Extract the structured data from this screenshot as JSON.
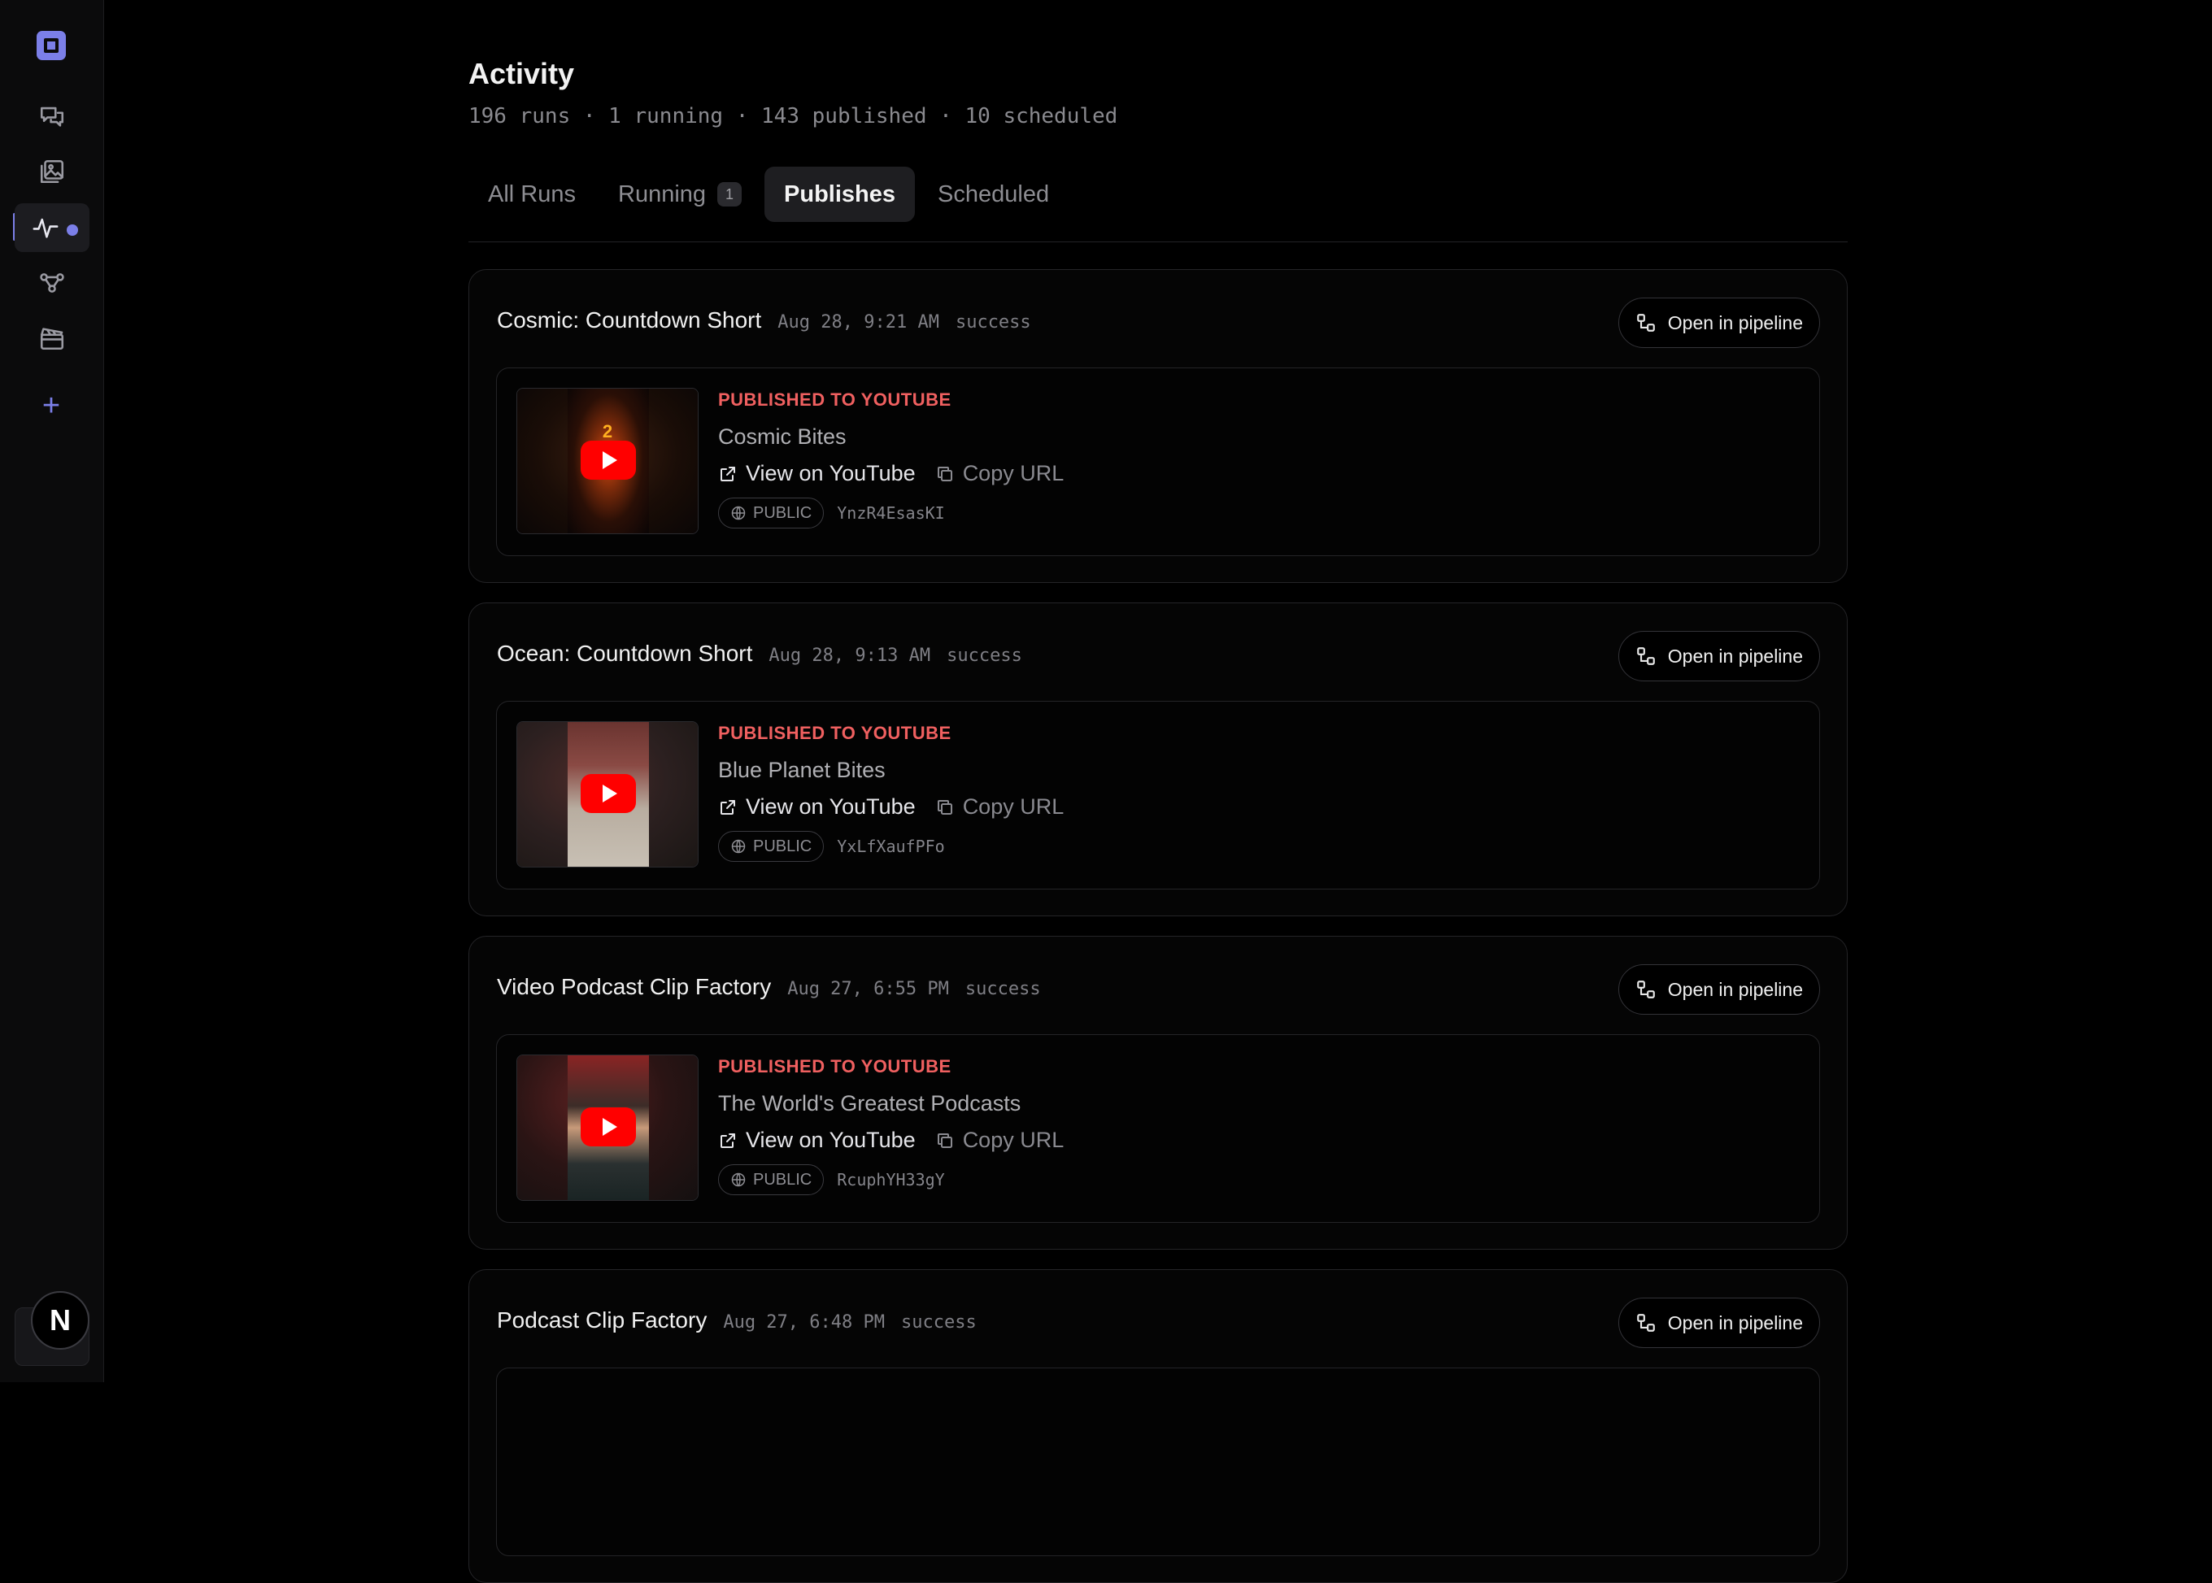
{
  "page": {
    "title": "Activity",
    "summary": "196 runs · 1 running · 143 published · 10 scheduled"
  },
  "tabs": [
    {
      "label": "All Runs"
    },
    {
      "label": "Running",
      "count": "1"
    },
    {
      "label": "Publishes"
    },
    {
      "label": "Scheduled"
    }
  ],
  "active_tab": "Publishes",
  "sidebar": {
    "items": [
      {
        "icon": "chat-icon"
      },
      {
        "icon": "gallery-icon"
      },
      {
        "icon": "activity-icon",
        "active": true
      },
      {
        "icon": "workflow-icon"
      },
      {
        "icon": "clapperboard-icon"
      }
    ],
    "add_icon": "plus-icon",
    "user_initial": "N",
    "accent_color": "#7b7fe8"
  },
  "runs": [
    {
      "title": "Cosmic: Countdown Short",
      "time": "Aug 28, 9:21 AM",
      "status": "success",
      "open_label": "Open in pipeline",
      "publish": {
        "destination": "PUBLISHED TO YOUTUBE",
        "channel": "Cosmic Bites",
        "view_label": "View on YouTube",
        "copy_label": "Copy URL",
        "visibility": "PUBLIC",
        "video_id": "YnzR4EsasKI"
      }
    },
    {
      "title": "Ocean: Countdown Short",
      "time": "Aug 28, 9:13 AM",
      "status": "success",
      "open_label": "Open in pipeline",
      "publish": {
        "destination": "PUBLISHED TO YOUTUBE",
        "channel": "Blue Planet Bites",
        "view_label": "View on YouTube",
        "copy_label": "Copy URL",
        "visibility": "PUBLIC",
        "video_id": "YxLfXaufPFo"
      }
    },
    {
      "title": "Video Podcast Clip Factory",
      "time": "Aug 27, 6:55 PM",
      "status": "success",
      "open_label": "Open in pipeline",
      "publish": {
        "destination": "PUBLISHED TO YOUTUBE",
        "channel": "The World's Greatest Podcasts",
        "view_label": "View on YouTube",
        "copy_label": "Copy URL",
        "visibility": "PUBLIC",
        "video_id": "RcuphYH33gY"
      }
    },
    {
      "title": "Podcast Clip Factory",
      "time": "Aug 27, 6:48 PM",
      "status": "success",
      "open_label": "Open in pipeline"
    }
  ],
  "colors": {
    "background": "#000000",
    "publish_label": "#f06060",
    "youtube_red": "#ff0000"
  }
}
